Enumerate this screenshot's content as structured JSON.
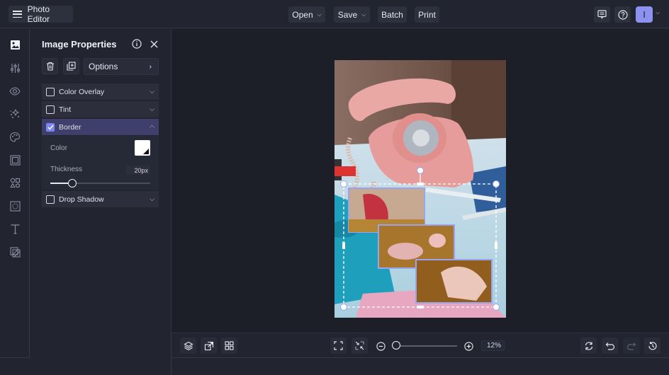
{
  "app": {
    "title": "Photo Editor"
  },
  "header": {
    "menu": [
      {
        "label": "Open",
        "has_dropdown": true
      },
      {
        "label": "Save",
        "has_dropdown": true
      },
      {
        "label": "Batch",
        "has_dropdown": false
      },
      {
        "label": "Print",
        "has_dropdown": false
      }
    ],
    "icons": [
      "feedback-icon",
      "help-icon"
    ],
    "avatar_initial": "I",
    "avatar_color": "#8b92f0"
  },
  "rail": {
    "items": [
      {
        "name": "image-properties",
        "active": true
      },
      {
        "name": "adjustments",
        "active": false
      },
      {
        "name": "effects",
        "active": false
      },
      {
        "name": "touch-up",
        "active": false
      },
      {
        "name": "artsy",
        "active": false
      },
      {
        "name": "frames",
        "active": false
      },
      {
        "name": "graphics",
        "active": false
      },
      {
        "name": "overlays",
        "active": false
      },
      {
        "name": "text",
        "active": false
      },
      {
        "name": "textures",
        "active": false
      }
    ]
  },
  "panel": {
    "title": "Image Properties",
    "options_label": "Options",
    "sections": [
      {
        "label": "Color Overlay",
        "checked": false,
        "expanded": false
      },
      {
        "label": "Tint",
        "checked": false,
        "expanded": false
      },
      {
        "label": "Border",
        "checked": true,
        "expanded": true
      },
      {
        "label": "Drop Shadow",
        "checked": false,
        "expanded": false
      }
    ],
    "border": {
      "color_label": "Color",
      "color_value": "#ffffff",
      "thickness_label": "Thickness",
      "thickness_value": "20px",
      "thickness_fraction": 0.22
    }
  },
  "bottombar": {
    "zoom_value": "12%",
    "zoom_fraction": 0.0
  },
  "colors": {
    "accent": "#7c86f2",
    "bg": "#22242f",
    "stage": "#1d1f28"
  }
}
